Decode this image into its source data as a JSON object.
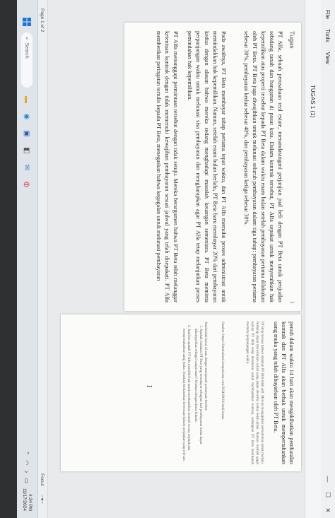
{
  "menubar": {
    "items": [
      "File",
      "Tools",
      "View"
    ],
    "title": "TUGAS 1 (1)"
  },
  "left_page": {
    "heading": "Tugas",
    "page_number": "1",
    "paragraphs": [
      "PT Alfa, sebuah perusahaan real estate, menandatangani perjanjian jual beli dengan PT Beta untuk penjualan sebidang tanah dan bangunan di pusat kota. Dalam kontrak tersebut, PT Alfa sepakat untuk menyerahkan hak kepemilikan atas properti tersebut kepada PT Beta dalam waktu enam bulan setelah pembayaran pertama dilakukan oleh PT Beta. PT Beta juga diwajibkan untuk melunasi seluruh pembayaran dalam tiga tahap: pembayaran pertama sebesar 30%, pembayaran kedua sebesar 40%, dan pembayaran ketiga sebesar 30%.",
      "Pada awalnya, PT Beta membayar tahap pertama tepat waktu, dan PT Alfa memulai proses administrasi untuk memindahkan hak kepemilikan. Namun, setelah enam bulan berlalu, PT Beta baru membayar 20% dari pembayaran kedua dengan alasan bahwa mereka sedang menghadapi masalah keuangan sementara. PT Beta meminta perpanjangan waktu untuk melunasi sisa pembayaran dan mengharapkan agar PT Alfa tetap melanjutkan proses pemindahan hak kepemilikan.",
      "PT Alfa menanggapi permintaan tersebut dengan tidak setuju. Mereka berargumen bahwa PT Beta telah melanggar ketentuan kontrak dengan tidak memenuhi kewajiban pembayaran sesuai jadwal yang telah disepakati. PT Alfa memberikan peringatan tertulis kepada PT Beta, menegaskan bahwa kegagalan untuk melunasi pembayaran"
    ]
  },
  "right_page": {
    "paragraph": "penuh dalam waktu 14 hari akan mengakibatkan pembatalan kontrak dan PT Alfa akan berhak untuk mempertahankan uang muka yang telah dibayarkan oleh PT Beta.",
    "note": "PT Beta merasa bahwa tindakan PT Alfa tidak adil. Mereka mengajukan permohonan untuk mediasi, berharap dapat menemukan solusi yang dapat diterima kedua belah pihak. Namun, mediasi gagal karena PT Alfa tetap bersikeras untuk membatalkan kontrak, sedangkan PT Beta bersikukuh meminta perpanjangan waktu.",
    "source_label": "Sumber: https://ilmuhukum.kompasiana.com/2024/08/18/studi-kasus",
    "intro": "Analisislah kasus di atas dengan menjawab pertanyaan berikut:",
    "questions": [
      "Apakah tindakan PT Beta yang membayar sebagian dari pembayaran kedua dapat dikategorikan sebagai wanprestasi? Jelaskan dengan dasar hukum.",
      "Analisis apakah PT Alfa memiliki hak untuk membatalkan kontrak secara sepihak dan mempertahankan uang muka. Jelaskan berdasarkan ketentuan hukum perjanjian yang relevan."
    ]
  },
  "statusbar": {
    "page_indicator": "Page 1 of 2",
    "focus_label": "Focus"
  },
  "taskbar": {
    "search_placeholder": "Search",
    "date": "11/17/2024",
    "time": "4:34 PM"
  },
  "icons": {
    "start": "windows-start-icon",
    "search": "search-icon"
  }
}
